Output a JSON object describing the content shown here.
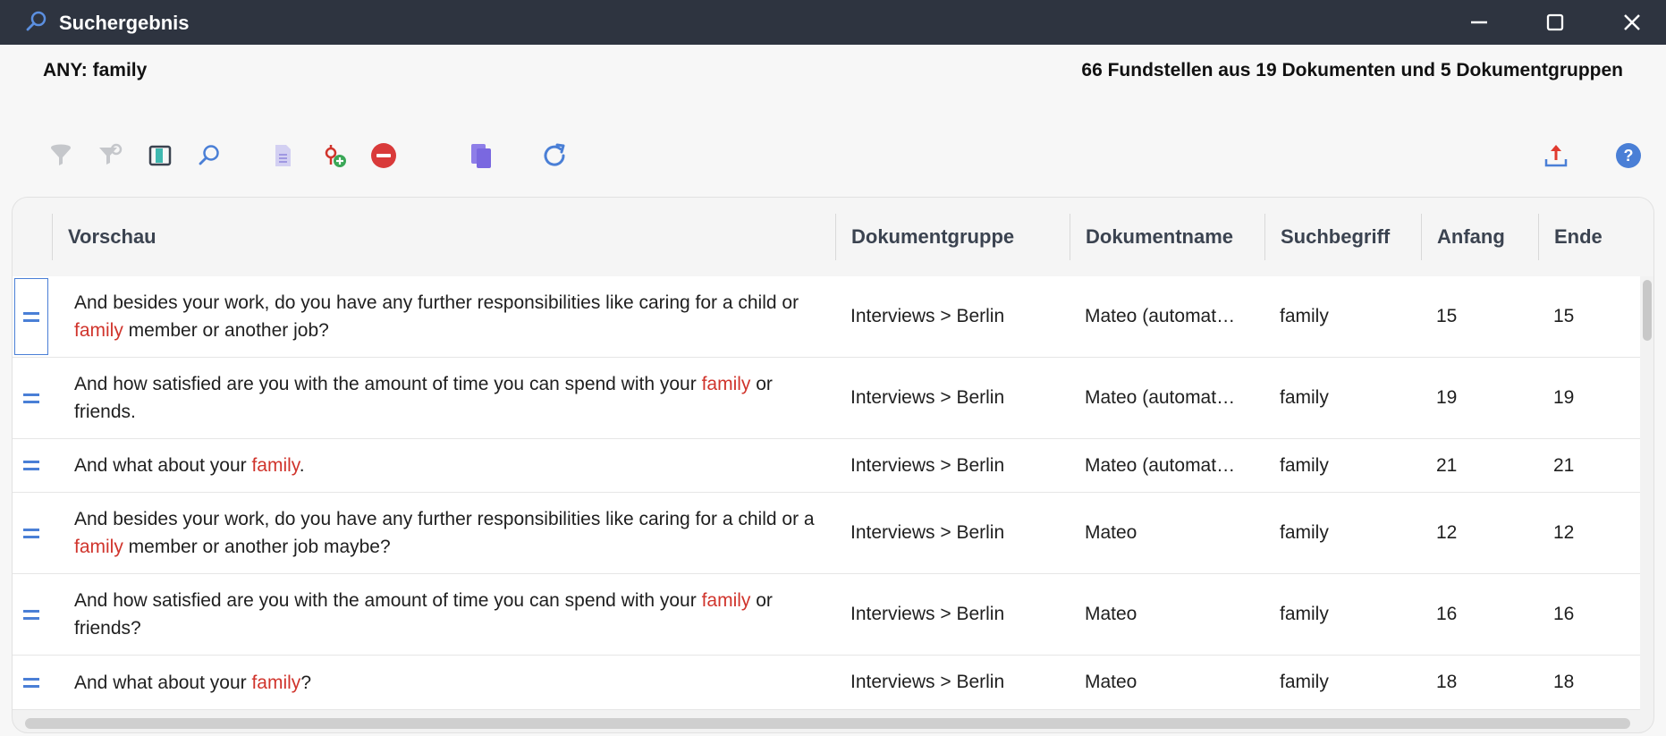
{
  "window": {
    "title": "Suchergebnis"
  },
  "header": {
    "query": "ANY: family",
    "summary": "66 Fundstellen aus 19 Dokumenten und 5 Dokumentgruppen"
  },
  "toolbar": {
    "icons": [
      "filter-icon",
      "filter-settings-icon",
      "columns-icon",
      "search-icon",
      "document-list-icon",
      "add-code-icon",
      "remove-icon",
      "copy-icon",
      "refresh-icon",
      "export-icon",
      "help-icon"
    ]
  },
  "table": {
    "columns": [
      "Vorschau",
      "Dokumentgruppe",
      "Dokumentname",
      "Suchbegriff",
      "Anfang",
      "Ende"
    ],
    "rows": [
      {
        "pre": "And besides your work, do you have any further responsibilities like caring for a child or ",
        "hit": "family",
        "post": " member or another job?",
        "group": "Interviews > Berlin",
        "doc": "Mateo (automat…",
        "term": "family",
        "start": "15",
        "end": "15"
      },
      {
        "pre": "And how satisfied are you with the amount of time you can spend with your ",
        "hit": "family",
        "post": " or friends.",
        "group": "Interviews > Berlin",
        "doc": "Mateo (automat…",
        "term": "family",
        "start": "19",
        "end": "19"
      },
      {
        "pre": "And what about your ",
        "hit": "family",
        "post": ".",
        "group": "Interviews > Berlin",
        "doc": "Mateo (automat…",
        "term": "family",
        "start": "21",
        "end": "21"
      },
      {
        "pre": "And besides your work, do you have any further responsibilities like caring for a child or a ",
        "hit": "family",
        "post": " member or another job maybe?",
        "group": "Interviews > Berlin",
        "doc": "Mateo",
        "term": "family",
        "start": "12",
        "end": "12"
      },
      {
        "pre": "And how satisfied are you with the amount of time you can spend with your ",
        "hit": "family",
        "post": " or friends?",
        "group": "Interviews > Berlin",
        "doc": "Mateo",
        "term": "family",
        "start": "16",
        "end": "16"
      },
      {
        "pre": "And what about your ",
        "hit": "family",
        "post": "?",
        "group": "Interviews > Berlin",
        "doc": "Mateo",
        "term": "family",
        "start": "18",
        "end": "18"
      }
    ]
  },
  "colors": {
    "titlebar": "#2e3440",
    "highlight": "#d0342c",
    "accent": "#4a7fd6"
  }
}
